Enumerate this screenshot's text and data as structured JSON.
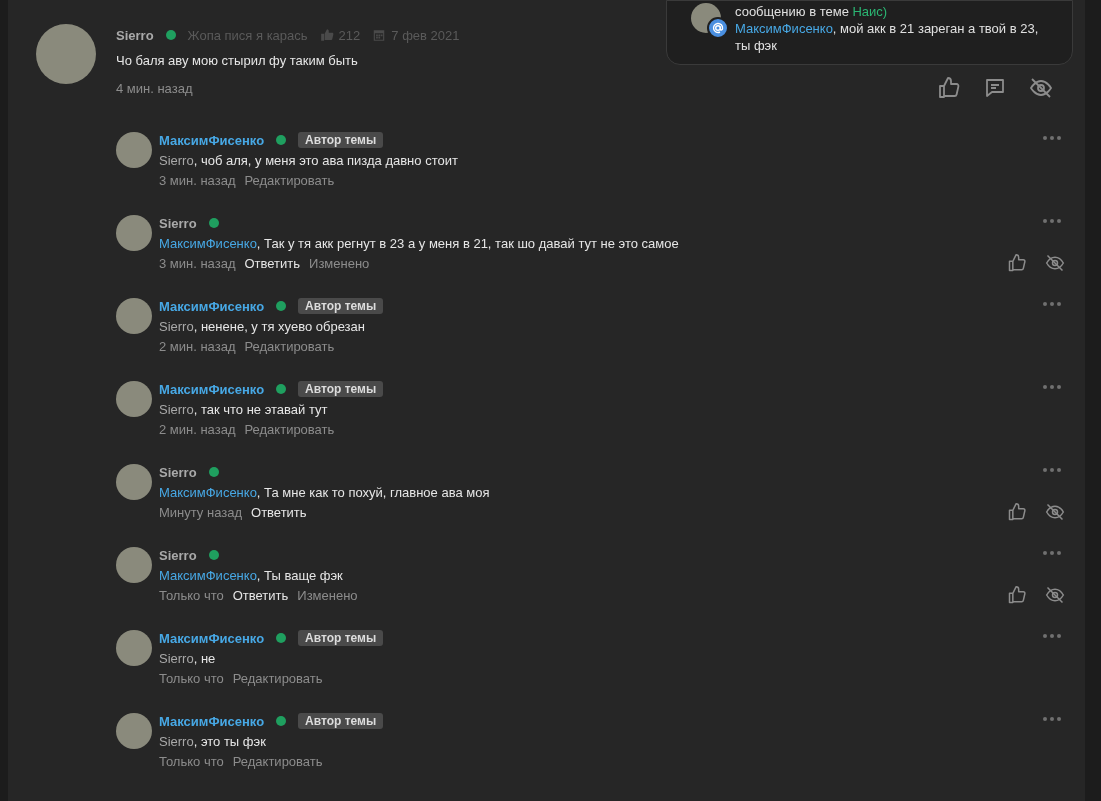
{
  "notification": {
    "line_1": "сообщению в теме ",
    "topic_link": "Наис)",
    "mention": "МаксимФисенко",
    "text": ", мой акк в 21 зареган а твой в 23, ты фэк"
  },
  "comment": {
    "author": "Sierro",
    "online": true,
    "status": "Жопа пися я карась",
    "likes": "212",
    "registered": "7 фев 2021",
    "text": "Чо баля аву мою стырил фу таким быть",
    "time": "4 мин. назад"
  },
  "replies": [
    {
      "author": "МаксимФисенко",
      "topic_author": true,
      "online": true,
      "badge": "Автор темы",
      "mention": "Sierro",
      "mention_topic_author": false,
      "text": ", чоб аля, у меня это ава пизда давно стоит",
      "actions": [
        {
          "label": "3 мин. назад",
          "kind": "time"
        },
        {
          "label": "Редактировать",
          "kind": "muted"
        }
      ],
      "show_reactions": false
    },
    {
      "author": "Sierro",
      "topic_author": false,
      "online": true,
      "mention": "МаксимФисенко",
      "mention_topic_author": true,
      "text": ", Так у тя акк регнут в 23 а у меня в 21, так шо давай тут не это самое",
      "actions": [
        {
          "label": "3 мин. назад",
          "kind": "time"
        },
        {
          "label": "Ответить",
          "kind": "link"
        },
        {
          "label": "Изменено",
          "kind": "muted"
        }
      ],
      "show_reactions": true
    },
    {
      "author": "МаксимФисенко",
      "topic_author": true,
      "online": true,
      "badge": "Автор темы",
      "mention": "Sierro",
      "mention_topic_author": false,
      "text": ", ненене, у тя хуево обрезан",
      "actions": [
        {
          "label": "2 мин. назад",
          "kind": "time"
        },
        {
          "label": "Редактировать",
          "kind": "muted"
        }
      ],
      "show_reactions": false
    },
    {
      "author": "МаксимФисенко",
      "topic_author": true,
      "online": true,
      "badge": "Автор темы",
      "mention": "Sierro",
      "mention_topic_author": false,
      "text": ", так что не этавай тут",
      "actions": [
        {
          "label": "2 мин. назад",
          "kind": "time"
        },
        {
          "label": "Редактировать",
          "kind": "muted"
        }
      ],
      "show_reactions": false
    },
    {
      "author": "Sierro",
      "topic_author": false,
      "online": true,
      "mention": "МаксимФисенко",
      "mention_topic_author": true,
      "text": ", Та мне как то похуй, главное ава моя",
      "actions": [
        {
          "label": "Минуту назад",
          "kind": "time"
        },
        {
          "label": "Ответить",
          "kind": "link"
        }
      ],
      "show_reactions": true
    },
    {
      "author": "Sierro",
      "topic_author": false,
      "online": true,
      "mention": "МаксимФисенко",
      "mention_topic_author": true,
      "text": ", Ты ваще фэк",
      "actions": [
        {
          "label": "Только что",
          "kind": "time"
        },
        {
          "label": "Ответить",
          "kind": "link"
        },
        {
          "label": "Изменено",
          "kind": "muted"
        }
      ],
      "show_reactions": true
    },
    {
      "author": "МаксимФисенко",
      "topic_author": true,
      "online": true,
      "badge": "Автор темы",
      "mention": "Sierro",
      "mention_topic_author": false,
      "text": ", не",
      "actions": [
        {
          "label": "Только что",
          "kind": "time"
        },
        {
          "label": "Редактировать",
          "kind": "muted"
        }
      ],
      "show_reactions": false
    },
    {
      "author": "МаксимФисенко",
      "topic_author": true,
      "online": true,
      "badge": "Автор темы",
      "mention": "Sierro",
      "mention_topic_author": false,
      "text": ", это ты фэк",
      "actions": [
        {
          "label": "Только что",
          "kind": "time"
        },
        {
          "label": "Редактировать",
          "kind": "muted"
        }
      ],
      "show_reactions": false
    }
  ]
}
